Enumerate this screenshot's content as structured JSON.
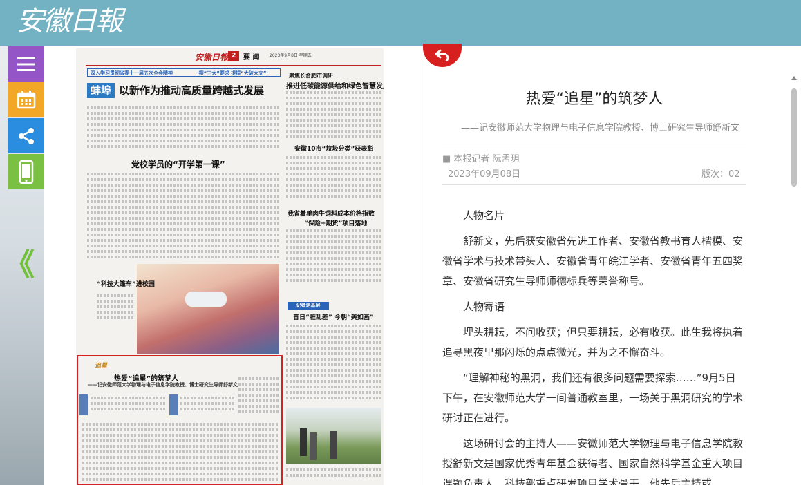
{
  "header": {
    "logo_text": "安徽日報"
  },
  "sidebar": {
    "menu_icon": "menu-icon",
    "calendar_icon": "calendar-icon",
    "share_icon": "share-icon",
    "mobile_icon": "mobile-icon",
    "prev_page_glyph": "《"
  },
  "newspaper": {
    "masthead": "安徽日報",
    "page_number": "2",
    "section": "要 闻",
    "date_line": "2023年9月8日 星期五",
    "top_banner": "深入学习贯彻省委十一届五次全会精神",
    "top_banner_right": "·摆“三大”要求 提振“大破大立”·",
    "city_badge": "蚌埠",
    "headline_main": "以新作为推动高质量跨越式发展",
    "headline_right_kicker": "聚焦长合肥市调研",
    "headline_right": "推进低碳能源供给和绿色智慧发展",
    "headline_school": "党校学员的“开学第一课”",
    "headline_garbage": "安徽10市“垃圾分类”获表彰",
    "headline_pig": "我省着单肉牛饲料成本价格指数",
    "headline_pig2": "“保险+期货”项目落地",
    "headline_tech": "“科技大篷车”进校园",
    "reporter_badge": "记者走基层",
    "headline_village": "昔日“脏乱差” 今朝“美如画”",
    "highlight_tag": "追星",
    "highlight_title": "热爱“追星”的筑梦人",
    "highlight_subtitle": "——记安徽师范大学物理与电子信息学院教授、博士研究生导师舒新文"
  },
  "article": {
    "back_icon": "back-arrow-icon",
    "title": "热爱“追星”的筑梦人",
    "subtitle": "——记安徽师范大学物理与电子信息学院教授、博士研究生导师舒新文",
    "author": "■ 本报记者 阮孟玥",
    "date": "2023年09月08日",
    "edition": "版次：02",
    "paragraphs": [
      "人物名片",
      "舒新文，先后获安徽省先进工作者、安徽省教书育人楷模、安徽省学术与技术带头人、安徽省青年皖江学者、安徽省青年五四奖章、安徽省研究生导师师德标兵等荣誉称号。",
      "人物寄语",
      "埋头耕耘，不问收获；但只要耕耘，必有收获。此生我将执着追寻黑夜里那闪烁的点点微光，并为之不懈奋斗。",
      "“理解神秘的黑洞，我们还有很多问题需要探索……”9月5日下午，在安徽师范大学一间普通教室里，一场关于黑洞研究的学术研讨正在进行。",
      "这场研讨会的主持人——安徽师范大学物理与电子信息学院教授舒新文是国家优秀青年基金获得者、国家自然科学基金重大项目课题负责人、科技部重点研发项目学术骨干，他先后主持或"
    ]
  }
}
